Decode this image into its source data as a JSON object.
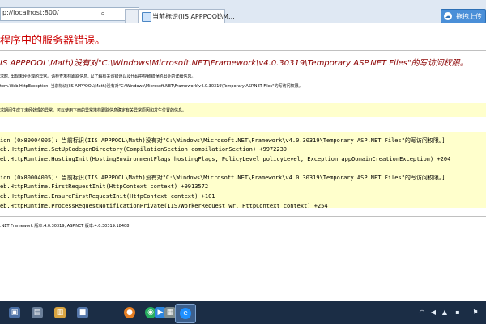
{
  "browser": {
    "address_text": "p://localhost:800/",
    "tab_title": "当前标识(IIS APPPOOL\\M...",
    "tab_close": "×",
    "addon_label": "拖拽上传",
    "search_icon": "search-icon",
    "refresh_icon": "refresh-icon"
  },
  "page": {
    "heading": "程序中的服务器错误。",
    "error_title": "IS APPPOOL\\Math)没有对\"C:\\Windows\\Microsoft.NET\\Framework\\v4.0.30319\\Temporary ASP.NET Files\"的写访问权限。",
    "description": "求时, 出现未经处理的异常。请检查堆栈跟踪信息, 以了解有关该错误以及代码中导致错误的出处的详细信息。",
    "exception": "tem.Web.HttpException: 当前标识(IIS APPPOOL\\Math)没有对\"C:\\Windows\\Microsoft.NET\\Framework\\v4.0.30319\\Temporary ASP.NET Files\"的写访问权限。",
    "source_note": "求期间生成了未经处理的异常。可以使用下面的异常堆栈跟踪信息确定有关异常原因和发生位置的信息。",
    "stack": [
      "ion (0x80004005): 当前标识(IIS APPPOOL\\Math)没有对\"C:\\Windows\\Microsoft.NET\\Framework\\v4.0.30319\\Temporary ASP.NET Files\"的写访问权限。]",
      "eb.HttpRuntime.SetUpCodegenDirectory(CompilationSection compilationSection) +9972230",
      "eb.HttpRuntime.HostingInit(HostingEnvironmentFlags hostingFlags, PolicyLevel policyLevel, Exception appDomainCreationException) +204",
      "ion (0x80004005): 当前标识(IIS APPPOOL\\Math)没有对\"C:\\Windows\\Microsoft.NET\\Framework\\v4.0.30319\\Temporary ASP.NET Files\"的写访问权限。]",
      "eb.HttpRuntime.FirstRequestInit(HttpContext context) +9913572",
      "eb.HttpRuntime.EnsureFirstRequestInit(HttpContext context) +101",
      "eb.HttpRuntime.ProcessRequestNotificationPrivate(IIS7WorkerRequest wr, HttpContext context) +254"
    ],
    "version": ".NET Framework 版本:4.0.30319; ASP.NET 版本:4.0.30319.18408"
  },
  "taskbar": {
    "apps": [
      {
        "icon": "app-icon",
        "color": "#4a6fa5",
        "glyph": "▣"
      },
      {
        "icon": "app-icon",
        "color": "#6b7f99",
        "glyph": "▤"
      },
      {
        "icon": "file-explorer-icon",
        "color": "#d9a441",
        "glyph": "▥"
      },
      {
        "icon": "app-icon",
        "color": "#5577aa",
        "glyph": "■"
      },
      {
        "icon": "firefox-icon",
        "color": "#e67e22",
        "glyph": "●"
      },
      {
        "icon": "chrome-icon",
        "color": "#27ae60",
        "glyph": "◉"
      },
      {
        "icon": "media-player-icon",
        "color": "#2e86de",
        "glyph": "▶"
      },
      {
        "icon": "app-icon",
        "color": "#7f8c8d",
        "glyph": "▦"
      },
      {
        "icon": "internet-explorer-icon",
        "color": "#1e90ff",
        "glyph": "e"
      }
    ],
    "tray": [
      {
        "icon": "wifi-icon",
        "glyph": "◠"
      },
      {
        "icon": "volume-icon",
        "glyph": "◀"
      },
      {
        "icon": "network-icon",
        "glyph": "▲"
      },
      {
        "icon": "keyboard-icon",
        "glyph": "▪"
      },
      {
        "icon": "flag-icon",
        "glyph": "⚑"
      }
    ]
  }
}
